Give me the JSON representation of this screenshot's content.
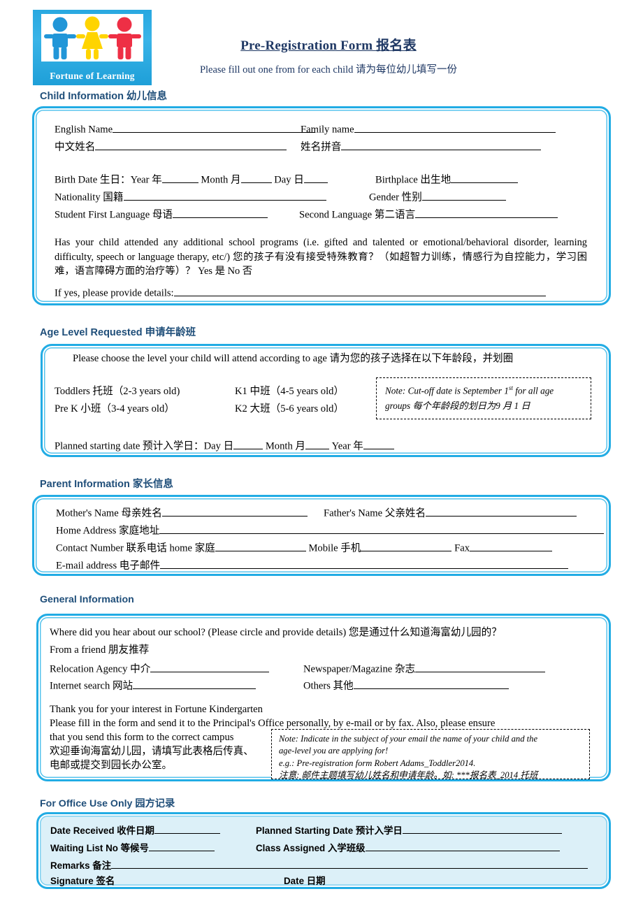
{
  "logo": {
    "caption": "Fortune of Learning",
    "figures": [
      "boy-blue",
      "girl-yellow",
      "boy-red"
    ],
    "colors": {
      "bg": "#29a8e0",
      "boy1": "#2196d8",
      "girl": "#ffd400",
      "boy2": "#ee2f45"
    }
  },
  "header": {
    "title": "Pre-Registration Form  报名表",
    "subtitle": "Please fill out one from for each child  请为每位幼儿填写一份",
    "title_color": "#1f3864"
  },
  "theme": {
    "border_color": "#22ace4",
    "heading_color": "#1f4e79",
    "office_fill": "#dcf0f8"
  },
  "child_information": {
    "heading": "Child Information  幼儿信息",
    "fields": {
      "english_name": "English Name",
      "family_name": "Family name",
      "chinese_name": "中文姓名",
      "name_pinyin": "姓名拼音",
      "birth_date": "Birth Date  生日：Year 年",
      "month": "Month  月",
      "day": "Day 日",
      "birthplace": "Birthplace  出生地",
      "nationality": "Nationality  国籍",
      "gender": "Gender 性别",
      "first_language": "Student First Language  母语",
      "second_language": "Second Language  第二语言"
    },
    "question": "Has your child attended any additional school programs (i.e. gifted and talented or emotional/behavioral disorder, learning difficulty, speech or language therapy, etc/)  您的孩子有没有接受特殊教育？（如超智力训练，情感行为自控能力，学习困难，语言障碍方面的治疗等）？ Yes  是 No  否",
    "details_label": "If yes, please provide details:"
  },
  "age_level": {
    "heading": "Age Level Requested  申请年龄班",
    "instruction": "Please choose the level your child will attend according to age 请为您的孩子选择在以下年龄段，并划圈",
    "levels": [
      {
        "name": "Toddlers  托班（2-3 years old)",
        "col": 1
      },
      {
        "name": "Pre K  小班（3-4 years old）",
        "col": 1
      },
      {
        "name": "K1  中班（4-5 years old）",
        "col": 2
      },
      {
        "name": "K2  大班（5-6 years old）",
        "col": 2
      }
    ],
    "note_line1_pre": "Note: Cut-off date is September 1",
    "note_line1_sup": "st",
    "note_line1_post": " for all age",
    "note_line2": "groups  每个年龄段的划日为9 月 1 日",
    "planned_start": {
      "label": "Planned starting date  预计入学日：Day  日",
      "month": "Month  月",
      "year": "Year  年"
    }
  },
  "parent_information": {
    "heading": "Parent Information 家长信息",
    "mothers_name": "Mother's Name  母亲姓名",
    "fathers_name": "Father's Name 父亲姓名",
    "home_address": "Home Address 家庭地址",
    "contact_number": "Contact Number 联系电话 home  家庭",
    "mobile": "Mobile  手机",
    "fax": "Fax",
    "email": "E-mail address 电子邮件"
  },
  "general_information": {
    "heading": "General Information",
    "question": "Where did you hear about our school? (Please circle and provide details)  您是通过什么知道海富幼儿园的？",
    "from_friend": "From a friend  朋友推荐",
    "relocation_agency": "Relocation Agency  中介",
    "newspaper": "Newspaper/Magazine  杂志",
    "internet_search": "Internet search 网站",
    "others": "Others  其他",
    "thanks_line": "Thank you for your interest in Fortune Kindergarten",
    "instruction_line1": "Please fill in the form and send it to the Principal's Office personally, by e-mail or by fax. Also, please ensure",
    "instruction_line2": "that you send this form to the correct campus",
    "instruction_cn1": "欢迎垂询海富幼儿园，请填写此表格后传真、",
    "instruction_cn2": "电邮或提交到园长办公室。",
    "note": {
      "line1": "Note: Indicate in the subject of your email the name of your child and the",
      "line2": "age-level you are applying for!",
      "line3": "e.g.: Pre-registration form Robert Adams_Toddler2014.",
      "line4": "注意: 邮件主题填写幼儿姓名和申请年龄。如: ***报名表_2014 托班"
    }
  },
  "office_use": {
    "heading": "For Office Use Only 园方记录",
    "date_received": "Date Received  收件日期",
    "planned_starting_date": "Planned Starting Date  预计入学日",
    "waiting_list_no": "Waiting List No  等候号",
    "class_assigned": "Class Assigned  入学班级",
    "remarks": "Remarks  备注",
    "signature": "Signature  签名",
    "date": "Date  日期"
  }
}
